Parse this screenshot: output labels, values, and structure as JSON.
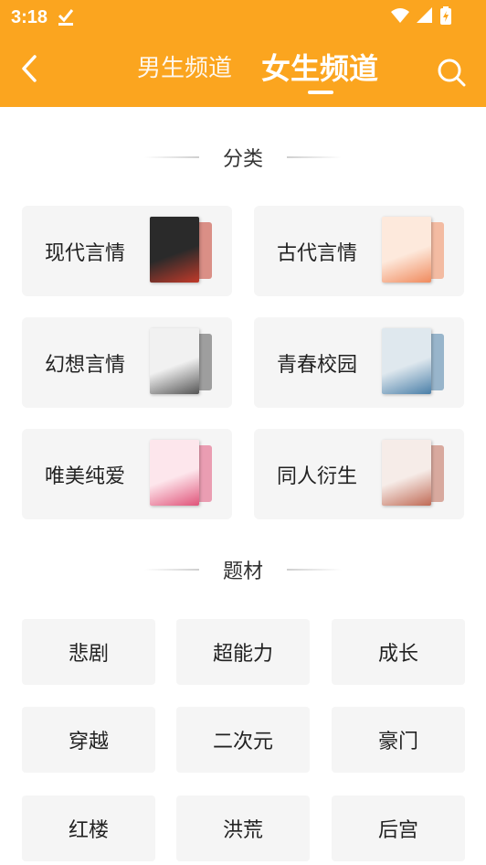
{
  "status": {
    "time": "3:18"
  },
  "header": {
    "tab_male": "男生频道",
    "tab_female": "女生频道"
  },
  "section_category": {
    "title": "分类"
  },
  "categories": [
    {
      "label": "现代言情",
      "book_colors": [
        "#2a2a2a",
        "#c23a2a"
      ]
    },
    {
      "label": "古代言情",
      "book_colors": [
        "#fde9dc",
        "#f08a5d"
      ]
    },
    {
      "label": "幻想言情",
      "book_colors": [
        "#f1f1f1",
        "#555555"
      ]
    },
    {
      "label": "青春校园",
      "book_colors": [
        "#dfe8ee",
        "#4a7fa8"
      ]
    },
    {
      "label": "唯美纯爱",
      "book_colors": [
        "#fde6ec",
        "#e0547a"
      ]
    },
    {
      "label": "同人衍生",
      "book_colors": [
        "#f6ece8",
        "#c06a55"
      ]
    }
  ],
  "section_theme": {
    "title": "题材"
  },
  "themes": [
    "悲剧",
    "超能力",
    "成长",
    "穿越",
    "二次元",
    "豪门",
    "红楼",
    "洪荒",
    "后宫"
  ]
}
